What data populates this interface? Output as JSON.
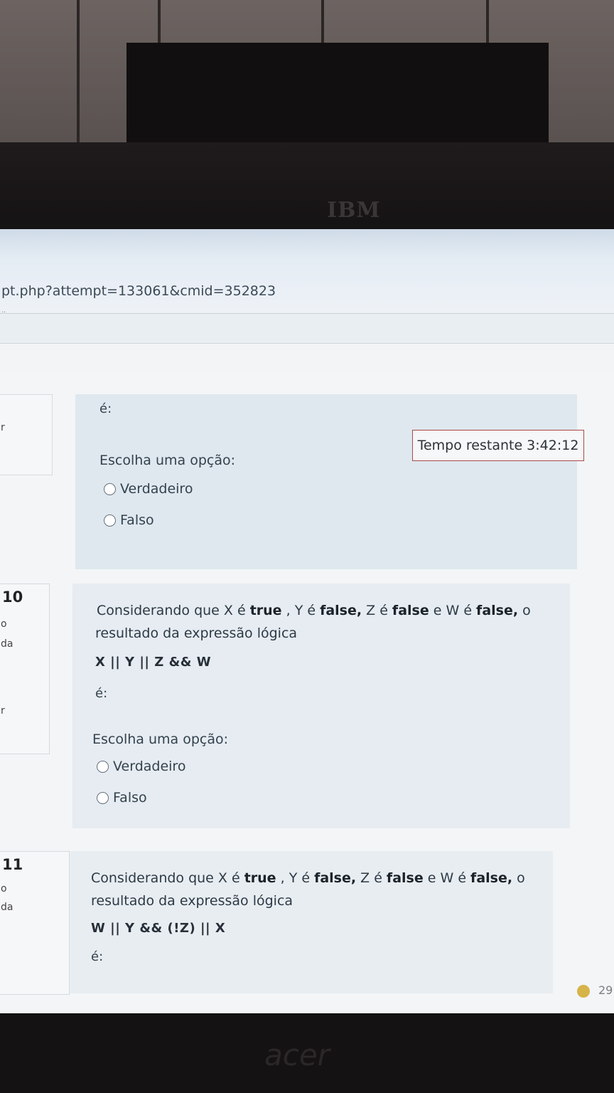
{
  "browser": {
    "url": "pt.php?attempt=133061&cmid=352823",
    "dots": "··"
  },
  "timer": {
    "label": "Tempo restante",
    "value": "3:42:12"
  },
  "q9": {
    "side_label": "r",
    "e_label": "é:",
    "choose": "Escolha uma opção:",
    "opt1": "Verdadeiro",
    "opt2": "Falso"
  },
  "q10": {
    "number": "10",
    "side1": "o",
    "side2": "da",
    "side3": "r",
    "text_1": "Considerando que X é ",
    "b_true": "true",
    "text_2": " , Y é ",
    "b_false1": "false,",
    "text_3": " Z é ",
    "b_false2": "false",
    "text_4": " e W é ",
    "b_false3": "false,",
    "text_5": " o",
    "line2": "resultado da expressão lógica",
    "expression": "X || Y || Z && W",
    "e_label": "é:",
    "choose": "Escolha uma opção:",
    "opt1": "Verdadeiro",
    "opt2": "Falso"
  },
  "q11": {
    "number": "11",
    "side1": "o",
    "side2": "da",
    "text_1": "Considerando que X é ",
    "b_true": "true",
    "text_2": " , Y é ",
    "b_false1": "false,",
    "text_3": " Z é ",
    "b_false2": "false",
    "text_4": " e W é ",
    "b_false3": "false,",
    "text_5": " o",
    "line2": "resultado da expressão lógica",
    "expression": "W || Y && (!Z) || X",
    "e_label": "é:"
  },
  "taskbar": {
    "clock_partial": "29"
  },
  "hardware": {
    "monitor_brand": "IBM",
    "laptop_brand": "acer"
  }
}
